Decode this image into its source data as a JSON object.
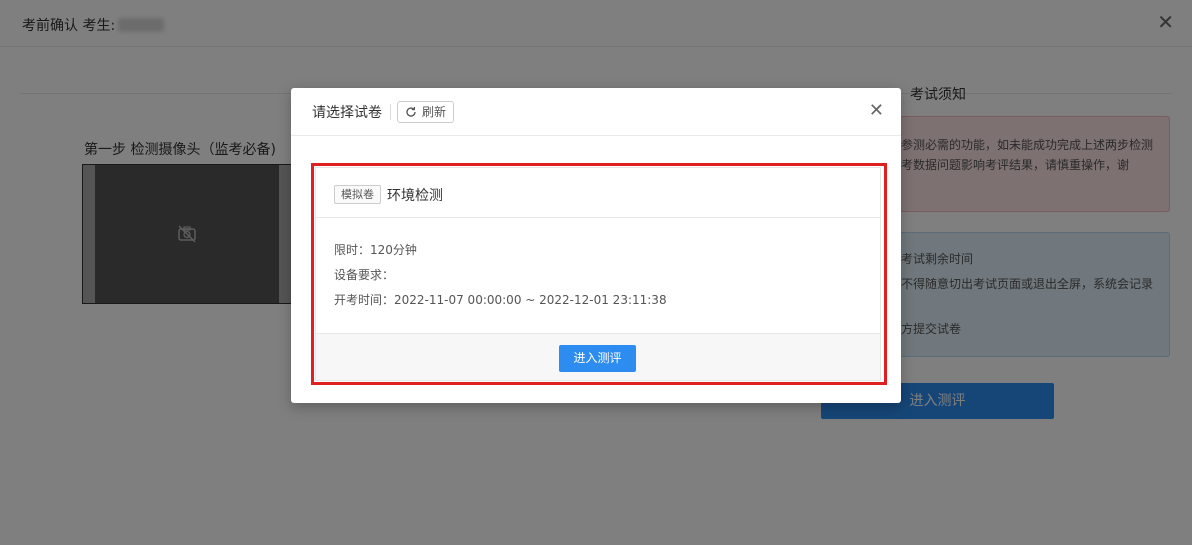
{
  "header": {
    "title": "考前确认 考生:"
  },
  "background": {
    "step1_title": "第一步 检测摄像头（监考必备)",
    "notice_title": "考试须知",
    "notice_red": {
      "line1": "参测必需的功能，如未能成功完成上述两步检测",
      "line2": "考数据问题影响考评结果，请慎重操作，谢"
    },
    "notice_blue": {
      "line1": "考试剩余时间",
      "line2": "不得随意切出考试页面或退出全屏，系统会记录",
      "line3": "方提交试卷"
    },
    "enter_button": "进入测评"
  },
  "modal": {
    "title": "请选择试卷",
    "refresh_label": "刷新",
    "paper": {
      "tag": "模拟卷",
      "name": "环境检测",
      "time_limit": "限时：120分钟",
      "device_req": "设备要求：",
      "exam_time": "开考时间：2022-11-07 00:00:00 ~ 2022-12-01 23:11:38",
      "enter_label": "进入测评"
    }
  },
  "colors": {
    "primary": "#2d8cf0",
    "highlight_border": "#e02020",
    "notice_red_bg": "#fde2e2",
    "notice_blue_bg": "#e1f0fb"
  }
}
